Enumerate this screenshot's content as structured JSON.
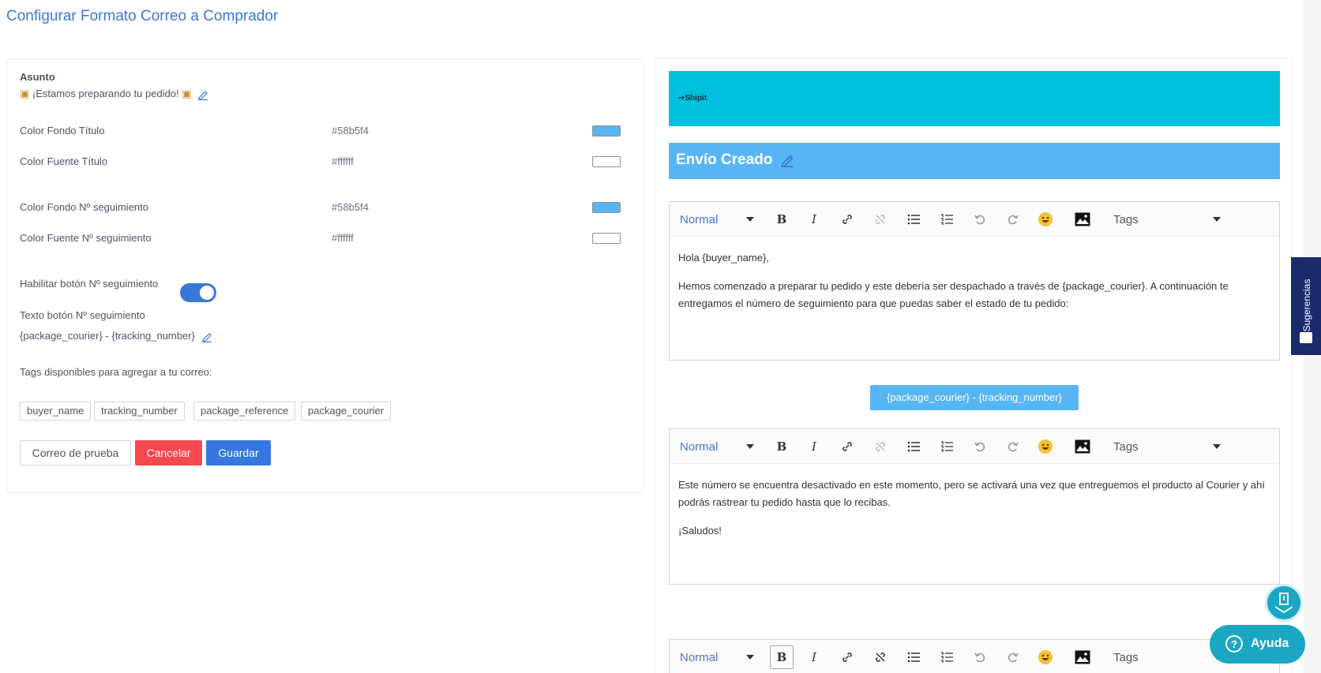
{
  "page": {
    "title": "Configurar Formato Correo a Comprador"
  },
  "form": {
    "subject_label": "Asunto",
    "subject_value": "¡Estamos preparando tu pedido!",
    "rows": [
      {
        "label": "Color Fondo Título",
        "hex": "#58b5f4",
        "swatch": "#58b5f4"
      },
      {
        "label": "Color Fuente Título",
        "hex": "#ffffff",
        "swatch": "#ffffff"
      },
      {
        "label": "Color Fondo Nº seguimiento",
        "hex": "#58b5f4",
        "swatch": "#58b5f4"
      },
      {
        "label": "Color Fuente Nº seguimiento",
        "hex": "#ffffff",
        "swatch": "#ffffff"
      }
    ],
    "toggle_label": "Habilitar botón Nº seguimiento",
    "toggle_on": true,
    "button_text_label": "Texto botón Nº seguimiento",
    "button_text_value": "{package_courier} - {tracking_number}",
    "tags_label": "Tags disponibles para agregar a tu correo:",
    "tags": [
      "buyer_name",
      "tracking_number",
      "package_reference",
      "package_courier"
    ],
    "buttons": {
      "test": "Correo de prueba",
      "cancel": "Cancelar",
      "save": "Guardar"
    }
  },
  "preview": {
    "brand": "Shipit",
    "header_title": "Envío Creado",
    "toolbar": {
      "format": "Normal",
      "tags": "Tags"
    },
    "editor1": {
      "p1": "Hola {buyer_name},",
      "p2": "Hemos comenzado a preparar tu pedido y este debería ser despachado a través de {package_courier}. A continuación te entregamos el número de seguimiento para que puedas saber el estado de tu pedido:"
    },
    "tracking_button": "{package_courier} - {tracking_number}",
    "editor2": {
      "p1": "Este número se encuentra desactivado en este momento, pero se activará una vez que entreguemos el producto al Courier y ahí podrás rastrear tu pedido hasta que lo recibas.",
      "p2": "¡Saludos!"
    }
  },
  "widgets": {
    "sugerencias": "Sugerencias",
    "ayuda": "Ayuda"
  },
  "colors": {
    "accent": "#3a78d6",
    "brand_bar": "#00c0dd",
    "title_bg": "#58b5f4",
    "cancel": "#f5484f"
  }
}
